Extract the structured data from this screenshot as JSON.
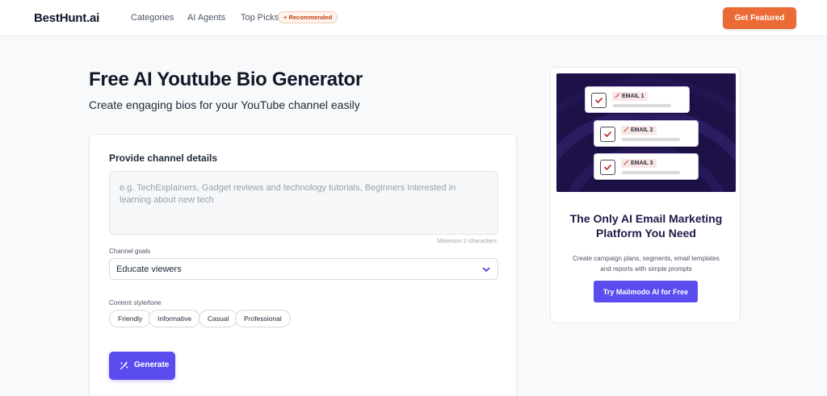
{
  "header": {
    "logo": "BestHunt.ai",
    "nav": [
      "Categories",
      "AI Agents",
      "Top Picks"
    ],
    "recommended_badge": "+ Recommended",
    "cta_label": "Get Featured",
    "cta_color": "#ec6a35"
  },
  "main": {
    "title": "Free AI Youtube Bio Generator",
    "subtitle": "Create engaging bios for your YouTube channel easily"
  },
  "form": {
    "section_title": "Provide channel details",
    "details_placeholder": "e.g. TechExplainers, Gadget reviews and technology tutorials, Beginners interested in learning about new tech",
    "min_chars_hint": "Minimum 2 characters",
    "goals_label": "Channel goals",
    "goals_selected": "Educate viewers",
    "tone_label": "Content style/tone",
    "tone_options": [
      "Friendly",
      "Informative",
      "Casual",
      "Professional"
    ],
    "generate_label": "Generate",
    "accent_color": "#5b4cf0"
  },
  "ad": {
    "emails": [
      "EMAIL 1",
      "EMAIL 2",
      "EMAIL 3"
    ],
    "title": "The Only AI Email Marketing Platform You Need",
    "description": "Create campaign plans, segments, email templates and reports with simple prompts",
    "cta_label": "Try Mailmodo AI for Free",
    "banner_color": "#1d1147"
  },
  "icons": [
    "chevron-down-icon",
    "magic-wand-icon",
    "checkmark-icon",
    "sparkle-icon"
  ]
}
